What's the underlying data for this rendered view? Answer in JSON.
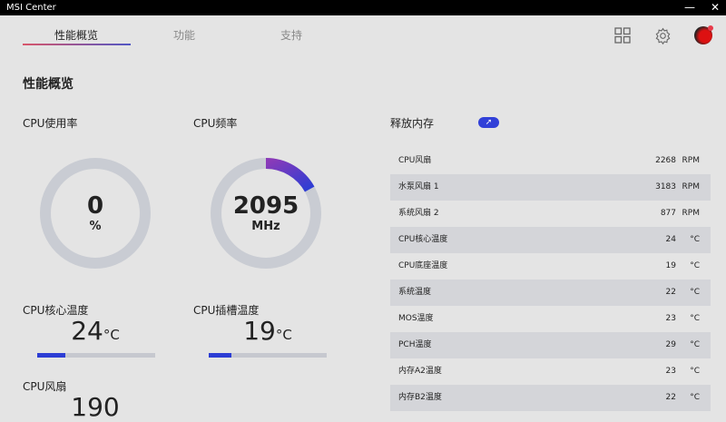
{
  "window": {
    "title": "MSI Center",
    "minimize": "—",
    "close": "✕"
  },
  "tabs": [
    "性能概览",
    "功能",
    "支持"
  ],
  "page_title": "性能概览",
  "cpu_usage": {
    "label": "CPU使用率",
    "value": "0",
    "unit": "%",
    "fraction": 0
  },
  "cpu_freq": {
    "label": "CPU频率",
    "value": "2095",
    "unit": "MHz",
    "fraction": 0.17
  },
  "cpu_core_temp": {
    "label": "CPU核心温度",
    "value": "24",
    "unit": "°C",
    "fraction": 0.24
  },
  "cpu_socket_temp": {
    "label": "CPU插槽温度",
    "value": "19",
    "unit": "°C",
    "fraction": 0.19
  },
  "cpu_fan": {
    "label": "CPU风扇",
    "value": "190"
  },
  "memory": {
    "label": "释放内存",
    "button_icon": "rocket-icon"
  },
  "sensors": [
    {
      "name": "CPU风扇",
      "value": "2268",
      "unit": "RPM"
    },
    {
      "name": "水泵风扇 1",
      "value": "3183",
      "unit": "RPM"
    },
    {
      "name": "系统风扇 2",
      "value": "877",
      "unit": "RPM"
    },
    {
      "name": "CPU核心温度",
      "value": "24",
      "unit": "°C"
    },
    {
      "name": "CPU底座温度",
      "value": "19",
      "unit": "°C"
    },
    {
      "name": "系统温度",
      "value": "22",
      "unit": "°C"
    },
    {
      "name": "MOS温度",
      "value": "23",
      "unit": "°C"
    },
    {
      "name": "PCH温度",
      "value": "29",
      "unit": "°C"
    },
    {
      "name": "内存A2温度",
      "value": "23",
      "unit": "°C"
    },
    {
      "name": "内存B2温度",
      "value": "22",
      "unit": "°C"
    }
  ],
  "colors": {
    "accent": "#2c3dd4",
    "track": "#c9ccd3"
  }
}
